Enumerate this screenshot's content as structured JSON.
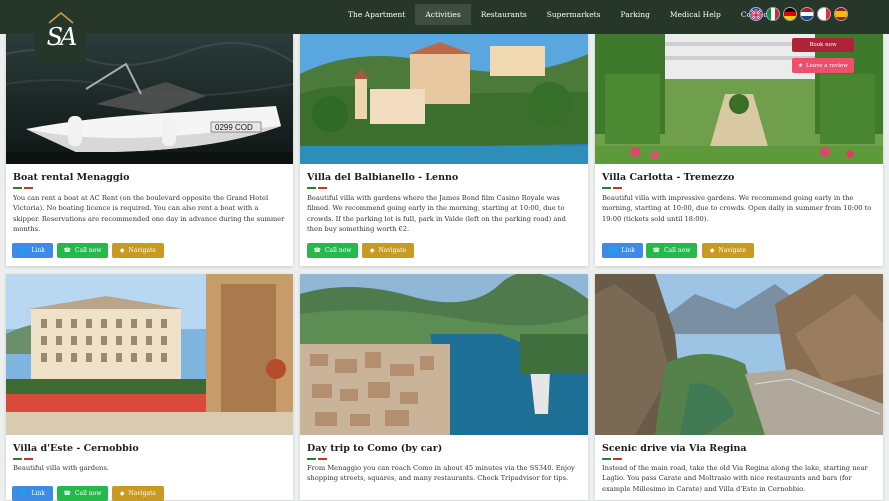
{
  "brand": {
    "logo_text": "SA"
  },
  "nav": {
    "items": [
      {
        "label": "The Apartment",
        "active": false
      },
      {
        "label": "Activities",
        "active": true
      },
      {
        "label": "Restaurants",
        "active": false
      },
      {
        "label": "Supermarkets",
        "active": false
      },
      {
        "label": "Parking",
        "active": false
      },
      {
        "label": "Medical Help",
        "active": false
      },
      {
        "label": "Contact",
        "active": false
      }
    ],
    "languages": [
      "English",
      "Italian",
      "German",
      "Dutch",
      "French",
      "Spanish"
    ]
  },
  "actions": {
    "book_now": "Book now",
    "leave_review": "Leave a review"
  },
  "buttons": {
    "link": "Link",
    "call": "Call now",
    "navigate": "Navigate"
  },
  "cards": [
    {
      "title": "Boat rental Menaggio",
      "description": "You can rent a boat at AC Rent (on the boulevard opposite the Grand Hotel Victoria). No boating licence is required. You can also rent a boat with a skipper. Reservations are recommended one day in advance during the summer months.",
      "image": "speedboat-on-lake"
    },
    {
      "title": "Villa del Balbianello - Lenno",
      "description": "Beautiful villa with gardens where the James Bond film Casino Royale was filmed. We recommend going early in the morning, starting at 10:00, due to crowds. If the parking lot is full, park in Valde (left on the parking road) and then buy something worth €2.",
      "image": "villa-on-peninsula"
    },
    {
      "title": "Villa Carlotta - Tremezzo",
      "description": "Beautiful villa with impressive gardens. We recommend going early in the morning, starting at 10:00, due to crowds. Open daily in summer from 10:00 to 19:00 (tickets sold until 18:00).",
      "image": "villa-with-gardens"
    },
    {
      "title": "Villa d'Este - Cernobbio",
      "description": "Beautiful villa with gardens.",
      "image": "grand-hotel-villa"
    },
    {
      "title": "Day trip to Como (by car)",
      "description": "From Menaggio you can reach Como in about 45 minutes via the SS340. Enjoy shopping streets, squares, and many restaurants. Check Tripadvisor for tips.",
      "image": "aerial-city-como"
    },
    {
      "title": "Scenic drive via Via Regina",
      "description": "Instead of the main road, take the old Via Regina along the lake, starting near Laglio. You pass Carate and Moltrasio with nice restaurants and bars (for example Millesimo in Carate) and Villa d'Este in Cernobbio.",
      "image": "mountain-road-gorge"
    }
  ],
  "colors": {
    "navbar": "#26372a",
    "accent_red": "#c0392b",
    "link_blue": "#3e8be6",
    "call_green": "#27b84b",
    "navigate_gold": "#c89a22",
    "book_now": "#b02236",
    "review_pink": "#ef4f6e"
  }
}
